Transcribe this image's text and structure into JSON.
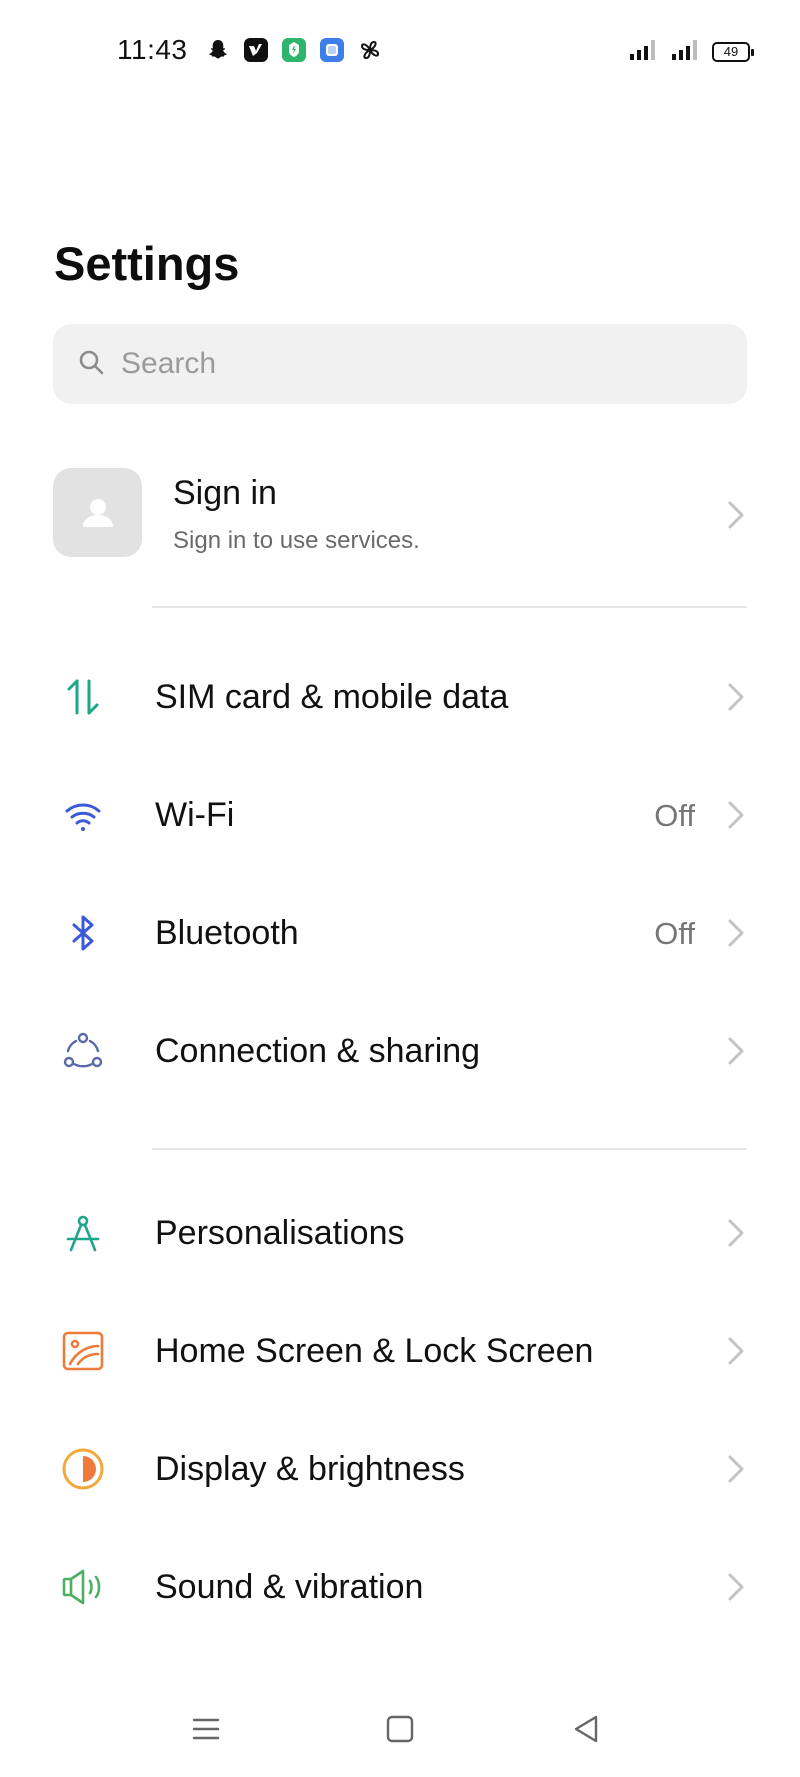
{
  "status_bar": {
    "time": "11:43",
    "battery": "49",
    "notification_icons": [
      "snapchat-icon",
      "vimeo-icon",
      "app-green-icon",
      "app-blue-icon",
      "pinwheel-icon"
    ]
  },
  "page": {
    "title": "Settings"
  },
  "search": {
    "placeholder": "Search",
    "value": ""
  },
  "account": {
    "title": "Sign in",
    "subtitle": "Sign in to use services."
  },
  "settings": [
    {
      "icon": "data-transfer-icon",
      "label": "SIM card & mobile data",
      "value": ""
    },
    {
      "icon": "wifi-icon",
      "label": "Wi-Fi",
      "value": "Off"
    },
    {
      "icon": "bluetooth-icon",
      "label": "Bluetooth",
      "value": "Off"
    },
    {
      "icon": "connection-sharing-icon",
      "label": "Connection & sharing",
      "value": ""
    },
    {
      "icon": "compass-icon",
      "label": "Personalisations",
      "value": ""
    },
    {
      "icon": "wallpaper-icon",
      "label": "Home Screen & Lock Screen",
      "value": ""
    },
    {
      "icon": "brightness-icon",
      "label": "Display & brightness",
      "value": ""
    },
    {
      "icon": "speaker-icon",
      "label": "Sound & vibration",
      "value": ""
    }
  ],
  "colors": {
    "teal": "#1fa58a",
    "blue": "#3b5bd6",
    "orange": "#ef7b3a",
    "amber": "#f2a93b",
    "green": "#4caf63",
    "chevron": "#c3c3c3"
  }
}
